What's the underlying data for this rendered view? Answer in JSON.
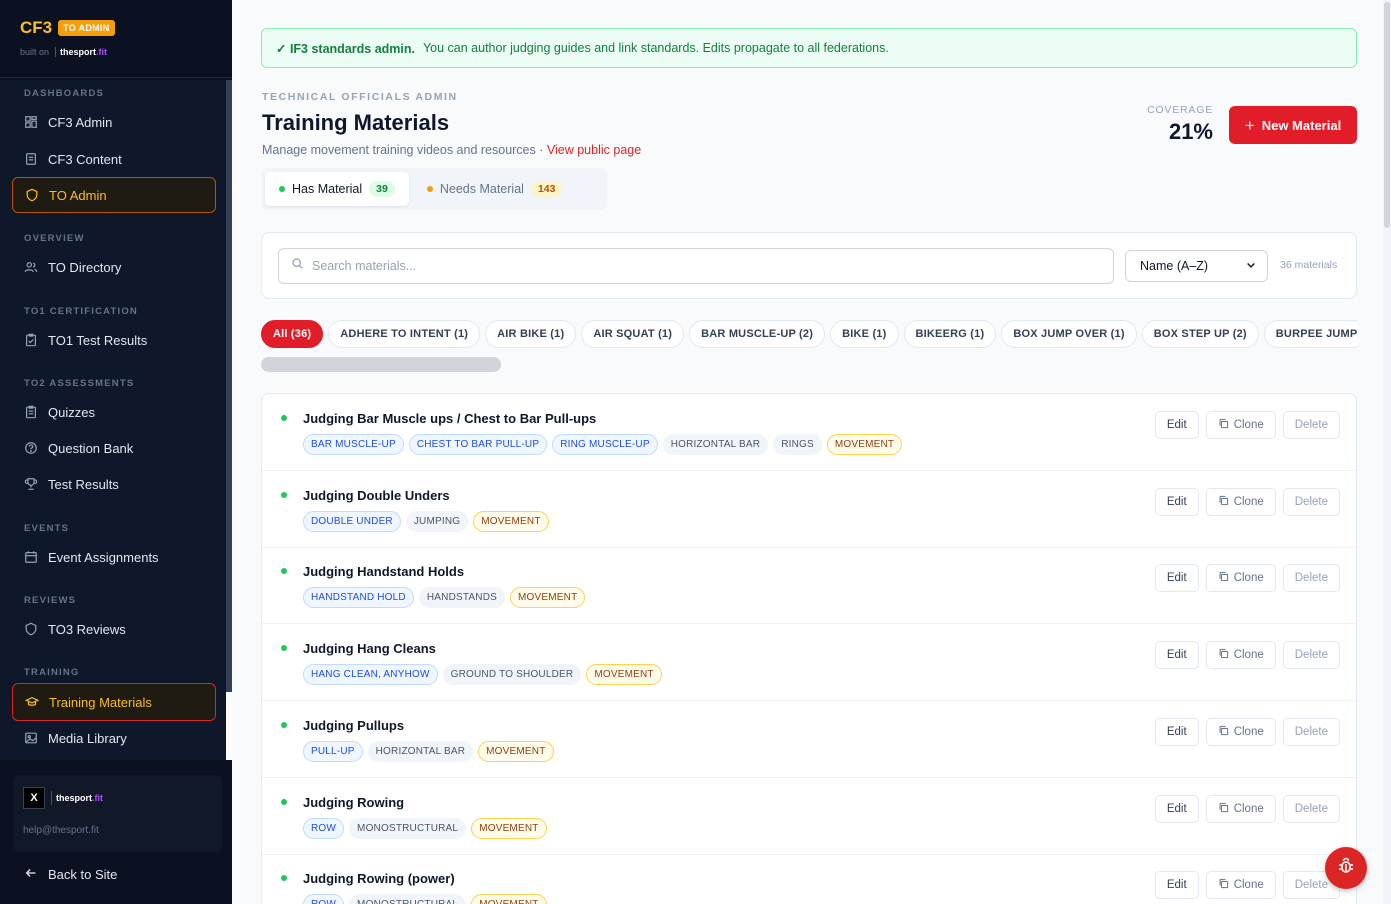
{
  "sidebar": {
    "brand": "CF3",
    "badge": "TO ADMIN",
    "built_on": "built on",
    "built_logo_a": "thesport",
    "built_logo_b": ".fit",
    "sections": {
      "dashboards": "DASHBOARDS",
      "overview": "OVERVIEW",
      "to1": "TO1 CERTIFICATION",
      "to2": "TO2 ASSESSMENTS",
      "events": "EVENTS",
      "reviews": "REVIEWS",
      "training": "TRAINING"
    },
    "items": {
      "cf3_admin": "CF3 Admin",
      "cf3_content": "CF3 Content",
      "to_admin": "TO Admin",
      "to_directory": "TO Directory",
      "to1_results": "TO1 Test Results",
      "quizzes": "Quizzes",
      "question_bank": "Question Bank",
      "test_results": "Test Results",
      "event_assignments": "Event Assignments",
      "to3_reviews": "TO3 Reviews",
      "training_materials": "Training Materials",
      "media_library": "Media Library"
    },
    "footer": {
      "logo_a": "thesport",
      "logo_b": ".fit",
      "email": "help@thesport.fit"
    },
    "back": "Back to Site"
  },
  "banner": {
    "strong": "✓ IF3 standards admin.",
    "text": "You can author judging guides and link standards. Edits propagate to all federations."
  },
  "header": {
    "eyebrow": "TECHNICAL OFFICIALS ADMIN",
    "title": "Training Materials",
    "subtitle": "Manage movement training videos and resources ·",
    "public_link": "View public page",
    "coverage_label": "COVERAGE",
    "coverage_value": "21%",
    "new_button": "New Material"
  },
  "tabs": [
    {
      "label": "Has Material",
      "count": "39"
    },
    {
      "label": "Needs Material",
      "count": "143"
    }
  ],
  "search": {
    "placeholder": "Search materials...",
    "sort": "Name (A–Z)",
    "count": "36 materials"
  },
  "filters": [
    "All (36)",
    "ADHERE TO INTENT (1)",
    "AIR BIKE (1)",
    "AIR SQUAT (1)",
    "BAR MUSCLE-UP (2)",
    "BIKE (1)",
    "BIKEERG (1)",
    "BOX JUMP OVER (1)",
    "BOX STEP UP (2)",
    "BURPEE JUMP OVER C"
  ],
  "actions": {
    "edit": "Edit",
    "clone": "Clone",
    "delete": "Delete"
  },
  "materials": [
    {
      "title": "Judging Bar Muscle ups / Chest to Bar Pull-ups",
      "tags": [
        {
          "label": "BAR MUSCLE-UP",
          "kind": "blue"
        },
        {
          "label": "CHEST TO BAR PULL-UP",
          "kind": "blue"
        },
        {
          "label": "RING MUSCLE-UP",
          "kind": "blue"
        },
        {
          "label": "HORIZONTAL BAR",
          "kind": "gray"
        },
        {
          "label": "RINGS",
          "kind": "gray"
        },
        {
          "label": "MOVEMENT",
          "kind": "amber"
        }
      ]
    },
    {
      "title": "Judging Double Unders",
      "tags": [
        {
          "label": "DOUBLE UNDER",
          "kind": "blue"
        },
        {
          "label": "JUMPING",
          "kind": "gray"
        },
        {
          "label": "MOVEMENT",
          "kind": "amber"
        }
      ]
    },
    {
      "title": "Judging Handstand Holds",
      "tags": [
        {
          "label": "HANDSTAND HOLD",
          "kind": "blue"
        },
        {
          "label": "HANDSTANDS",
          "kind": "gray"
        },
        {
          "label": "MOVEMENT",
          "kind": "amber"
        }
      ]
    },
    {
      "title": "Judging Hang Cleans",
      "tags": [
        {
          "label": "HANG CLEAN, ANYHOW",
          "kind": "blue"
        },
        {
          "label": "GROUND TO SHOULDER",
          "kind": "gray"
        },
        {
          "label": "MOVEMENT",
          "kind": "amber"
        }
      ]
    },
    {
      "title": "Judging Pullups",
      "tags": [
        {
          "label": "PULL-UP",
          "kind": "blue"
        },
        {
          "label": "HORIZONTAL BAR",
          "kind": "gray"
        },
        {
          "label": "MOVEMENT",
          "kind": "amber"
        }
      ]
    },
    {
      "title": "Judging Rowing",
      "tags": [
        {
          "label": "ROW",
          "kind": "blue"
        },
        {
          "label": "MONOSTRUCTURAL",
          "kind": "gray"
        },
        {
          "label": "MOVEMENT",
          "kind": "amber"
        }
      ]
    },
    {
      "title": "Judging Rowing (power)",
      "tags": [
        {
          "label": "ROW",
          "kind": "blue"
        },
        {
          "label": "MONOSTRUCTURAL",
          "kind": "gray"
        },
        {
          "label": "MOVEMENT",
          "kind": "amber"
        }
      ]
    }
  ]
}
